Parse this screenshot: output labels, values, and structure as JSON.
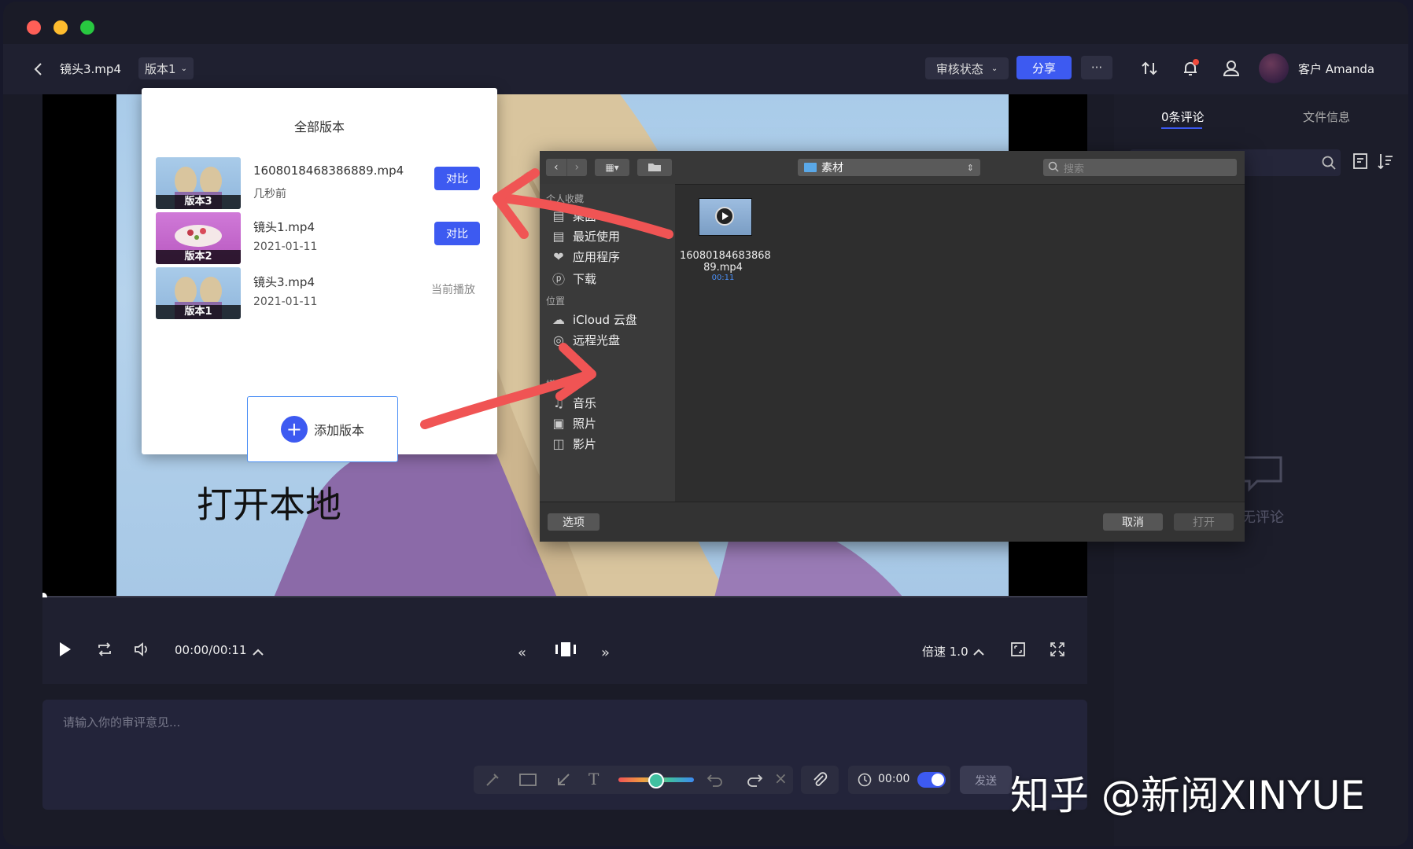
{
  "colors": {
    "accent": "#3d5af1",
    "close": "#fe5f57",
    "minimize": "#febc2e",
    "maximize": "#28c840",
    "arrow": "#f05454"
  },
  "header": {
    "back_icon": "chevron-left-icon",
    "file_name": "镜头3.mp4",
    "version_select": "版本1",
    "review_status": "审核状态",
    "share": "分享",
    "more": "···",
    "user_name": "客户 Amanda"
  },
  "right_panel": {
    "tabs": [
      "0条评论",
      "文件信息"
    ],
    "empty_text": "无评论"
  },
  "versions_popup": {
    "title": "全部版本",
    "items": [
      {
        "label": "版本3",
        "name": "1608018468386889.mp4",
        "date": "几秒前",
        "action": "对比"
      },
      {
        "label": "版本2",
        "name": "镜头1.mp4",
        "date": "2021-01-11",
        "action": "对比"
      },
      {
        "label": "版本1",
        "name": "镜头3.mp4",
        "date": "2021-01-11",
        "action": "当前播放"
      }
    ],
    "add_version": "添加版本"
  },
  "annotation_text": "打开本地",
  "finder": {
    "location": "素材",
    "search_placeholder": "搜索",
    "sections": {
      "favorites": "个人收藏",
      "locations": "位置",
      "media": "媒体"
    },
    "favorites": [
      "桌面",
      "最近使用",
      "应用程序",
      "下载"
    ],
    "locations": [
      "iCloud 云盘",
      "远程光盘"
    ],
    "media": [
      "音乐",
      "照片",
      "影片"
    ],
    "file": {
      "name_line1": "16080184683868",
      "name_line2": "89.mp4",
      "duration": "00:11"
    },
    "options": "选项",
    "cancel": "取消",
    "open": "打开"
  },
  "player": {
    "time": "00:00/00:11",
    "speed": "倍速 1.0",
    "progress": 0
  },
  "comment": {
    "placeholder": "请输入你的审评意见...",
    "timestamp": "00:00",
    "send": "发送"
  },
  "watermark": "知乎 @新阅XINYUE"
}
